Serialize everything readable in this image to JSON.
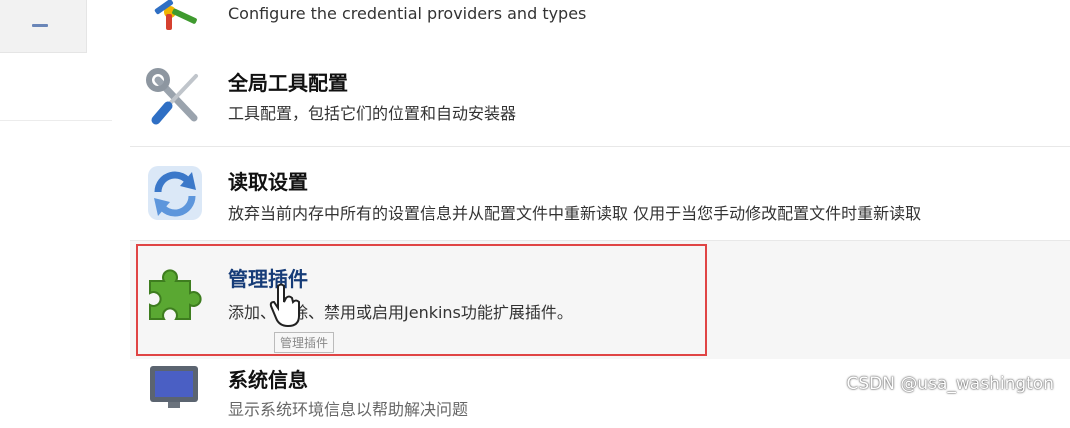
{
  "items": [
    {
      "id": "credentials",
      "title": "",
      "description": "Configure the credential providers and types",
      "icon": "keys-icon"
    },
    {
      "id": "tools",
      "title": "全局工具配置",
      "description": "工具配置，包括它们的位置和自动安装器",
      "icon": "wrench-screwdriver-icon"
    },
    {
      "id": "reload",
      "title": "读取设置",
      "description": "放弃当前内存中所有的设置信息并从配置文件中重新读取 仅用于当您手动修改配置文件时重新读取",
      "icon": "reload-arrows-icon"
    },
    {
      "id": "plugins",
      "title": "管理插件",
      "description": "添加、删除、禁用或启用Jenkins功能扩展插件。",
      "icon": "puzzle-piece-icon"
    },
    {
      "id": "sysinfo",
      "title": "系统信息",
      "description": "显示系统环境信息以帮助解决问题",
      "icon": "monitor-icon"
    }
  ],
  "tooltip": "管理插件",
  "watermark": "CSDN @usa_washington",
  "colors": {
    "highlight_border": "#e04545",
    "title_hover": "#163c78",
    "sidepanel_dash": "#6a86b8"
  }
}
